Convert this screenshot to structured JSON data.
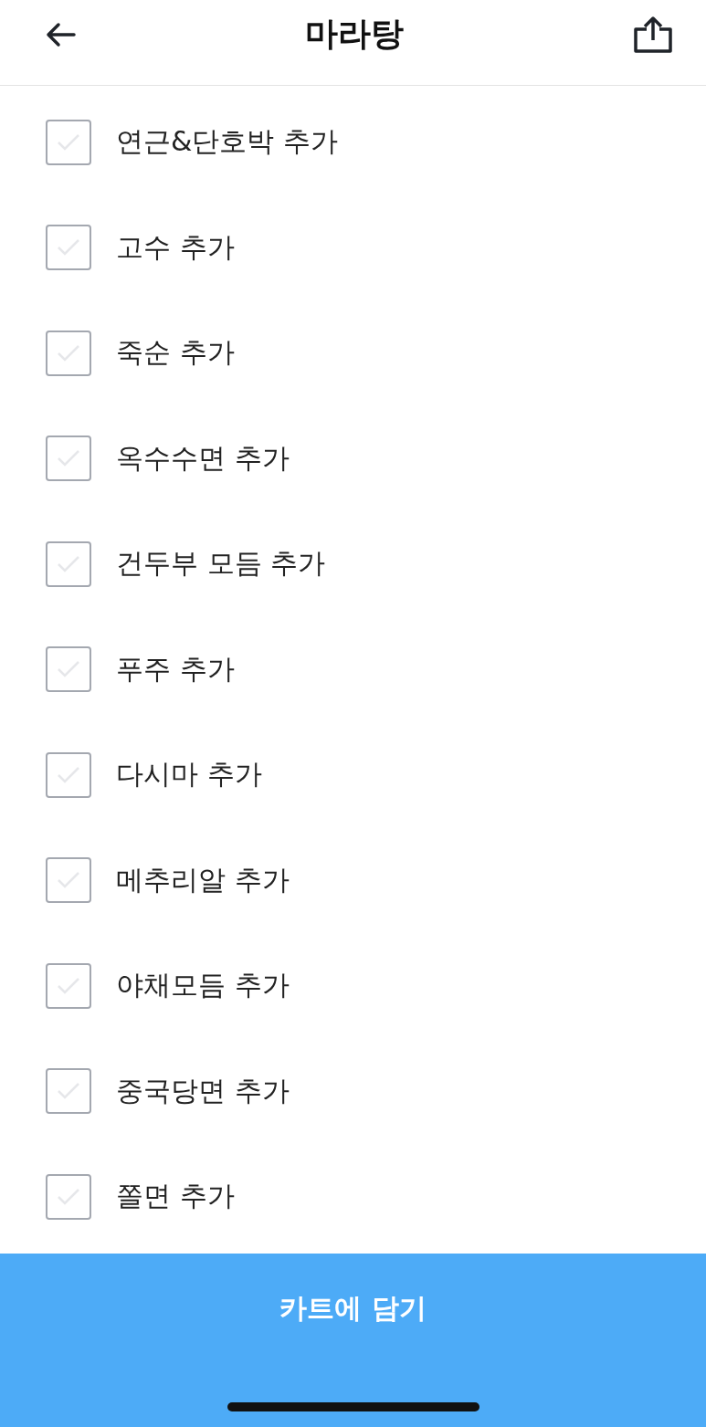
{
  "header": {
    "title": "마라탕"
  },
  "options": [
    {
      "label": "연근&단호박 추가",
      "checked": false
    },
    {
      "label": "고수 추가",
      "checked": false
    },
    {
      "label": "죽순 추가",
      "checked": false
    },
    {
      "label": "옥수수면 추가",
      "checked": false
    },
    {
      "label": "건두부 모듬 추가",
      "checked": false
    },
    {
      "label": "푸주 추가",
      "checked": false
    },
    {
      "label": "다시마 추가",
      "checked": false
    },
    {
      "label": "메추리알 추가",
      "checked": false
    },
    {
      "label": "야채모듬 추가",
      "checked": false
    },
    {
      "label": "중국당면 추가",
      "checked": false
    },
    {
      "label": "쫄면 추가",
      "checked": false
    }
  ],
  "cart_button": {
    "label": "카트에 담기"
  }
}
